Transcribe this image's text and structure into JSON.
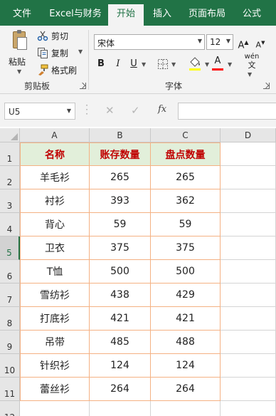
{
  "tabs": [
    {
      "label": "文件",
      "active": false
    },
    {
      "label": "Excel与财务",
      "active": false
    },
    {
      "label": "开始",
      "active": true
    },
    {
      "label": "插入",
      "active": false
    },
    {
      "label": "页面布局",
      "active": false
    },
    {
      "label": "公式",
      "active": false
    }
  ],
  "clipboard": {
    "paste": "粘贴",
    "cut": "剪切",
    "copy": "复制",
    "format_painter": "格式刷",
    "group_title": "剪贴板"
  },
  "font": {
    "name": "宋体",
    "size": "12",
    "bold": "B",
    "italic": "I",
    "underline": "U",
    "grow": "A",
    "shrink": "A",
    "font_color_letter": "A",
    "phonetic": "wén",
    "group_title": "字体"
  },
  "formula_bar": {
    "name_box": "U5",
    "cancel": "✕",
    "enter": "✓",
    "fx": "fx",
    "formula": ""
  },
  "columns": [
    "A",
    "B",
    "C",
    "D"
  ],
  "rows": [
    "1",
    "2",
    "3",
    "4",
    "5",
    "6",
    "7",
    "8",
    "9",
    "10",
    "11",
    "12"
  ],
  "selected_row": "5",
  "table": {
    "headers": [
      "名称",
      "账存数量",
      "盘点数量"
    ],
    "rows": [
      [
        "羊毛衫",
        "265",
        "265"
      ],
      [
        "衬衫",
        "393",
        "362"
      ],
      [
        "背心",
        "59",
        "59"
      ],
      [
        "卫衣",
        "375",
        "375"
      ],
      [
        "T恤",
        "500",
        "500"
      ],
      [
        "雪纺衫",
        "438",
        "429"
      ],
      [
        "打底衫",
        "421",
        "421"
      ],
      [
        "吊带",
        "485",
        "488"
      ],
      [
        "针织衫",
        "124",
        "124"
      ],
      [
        "蕾丝衫",
        "264",
        "264"
      ]
    ]
  },
  "colors": {
    "ribbon_green": "#217346",
    "header_fill": "#e2efda",
    "header_text": "#c00000",
    "table_border": "#f4b183",
    "font_color_bar": "#ff0000"
  }
}
